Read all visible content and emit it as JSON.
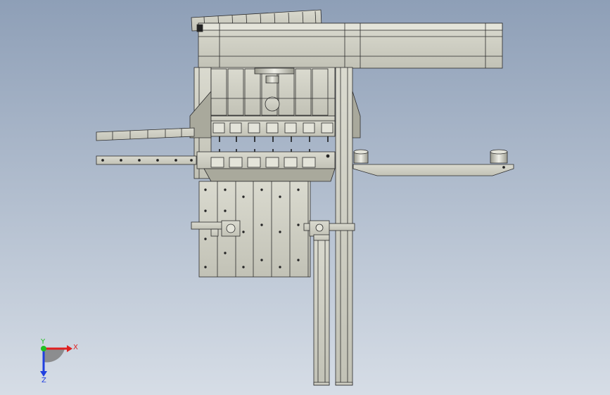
{
  "viewport": {
    "background_top": "#8e9fb7",
    "background_bottom": "#d6dde6"
  },
  "model": {
    "part_fill": "#cdcdc1",
    "part_stroke": "#2b2b2b",
    "shade_fill": "#a9a99c",
    "highlight_fill": "#e4e4da"
  },
  "triad": {
    "x_label": "X",
    "y_label": "Y",
    "z_label": "Z",
    "x_color": "#e02020",
    "y_color": "#20c020",
    "z_color": "#2040e0"
  }
}
